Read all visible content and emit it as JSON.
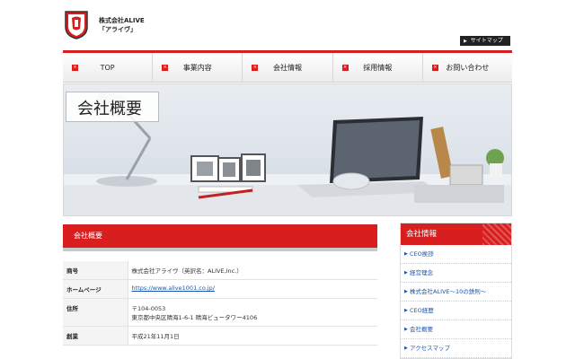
{
  "header": {
    "company_line1": "株式会社ALIVE",
    "company_line2": "「アライヴ」",
    "sitemap_label": "サイトマップ"
  },
  "nav": {
    "items": [
      {
        "label": "TOP"
      },
      {
        "label": "事業内容"
      },
      {
        "label": "会社情報"
      },
      {
        "label": "採用情報"
      },
      {
        "label": "お問い合わせ"
      }
    ]
  },
  "hero": {
    "title": "会社概要"
  },
  "main": {
    "section_title": "会社概要",
    "rows": [
      {
        "key": "商号",
        "value": "株式会社アライヴ（英訳名：ALIVE,Inc.）"
      },
      {
        "key": "ホームページ",
        "value": "https://www.alive1001.co.jp/"
      },
      {
        "key": "住所",
        "value": "〒104-0053",
        "value2": "東京都中央区晴海1-6-1 晴海ビュータワー4106"
      },
      {
        "key": "創業",
        "value": "平成21年11月1日"
      }
    ]
  },
  "sidebar": {
    "title": "会社情報",
    "items": [
      {
        "label": "CEO挨拶"
      },
      {
        "label": "経営理念"
      },
      {
        "label": "株式会社ALIVE～10の鉄則～"
      },
      {
        "label": "CEO経歴"
      },
      {
        "label": "会社概要"
      },
      {
        "label": "アクセスマップ"
      }
    ]
  },
  "colors": {
    "brand_red": "#d81e1e",
    "link_blue": "#1a55b0"
  }
}
